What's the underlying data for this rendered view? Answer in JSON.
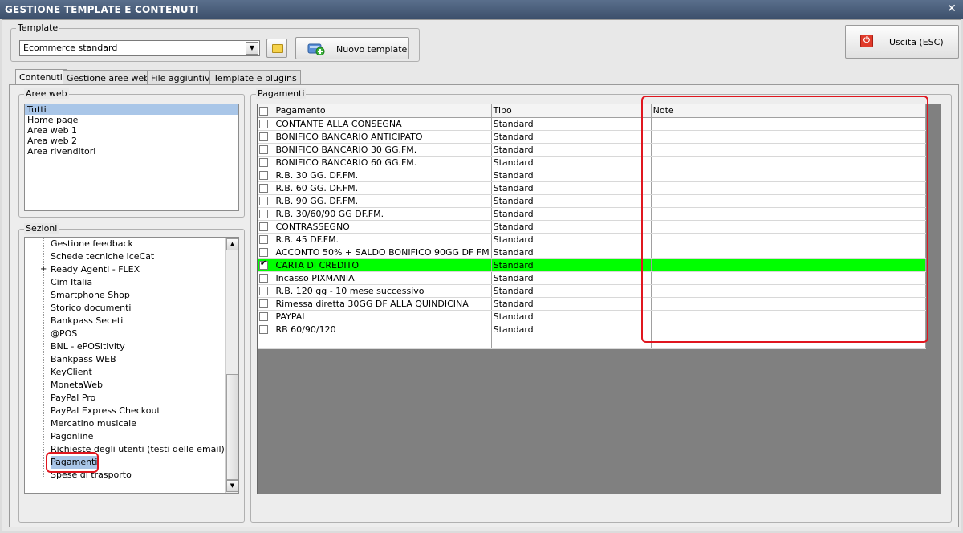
{
  "window": {
    "title": "GESTIONE TEMPLATE E CONTENUTI",
    "close_glyph": "✕"
  },
  "template_group": {
    "legend": "Template",
    "selected": "Ecommerce standard",
    "new_template_label": "Nuovo template",
    "exit_label": "Uscita (ESC)"
  },
  "tabs": [
    "Contenuti",
    "Gestione aree web",
    "File aggiuntivi",
    "Template e plugins"
  ],
  "aree_web": {
    "legend": "Aree web",
    "items": [
      "Tutti",
      "Home page",
      "Area web 1",
      "Area web 2",
      "Area rivenditori"
    ],
    "selected_index": 0
  },
  "sezioni": {
    "legend": "Sezioni",
    "items": [
      "Gestione feedback",
      "Schede tecniche IceCat",
      "Ready Agenti - FLEX",
      "Cim Italia",
      "Smartphone Shop",
      "Storico documenti",
      "Bankpass Seceti",
      "@POS",
      "BNL - ePOSitivity",
      "Bankpass WEB",
      "KeyClient",
      "MonetaWeb",
      "PayPal Pro",
      "PayPal Express Checkout",
      "Mercatino musicale",
      "Pagonline",
      "Richieste degli utenti (testi delle email)",
      "Pagamenti",
      "Spese di trasporto"
    ],
    "selected": "Pagamenti"
  },
  "pagamenti": {
    "legend": "Pagamenti",
    "columns": [
      "Pagamento",
      "Tipo",
      "Note"
    ],
    "rows": [
      {
        "pagamento": "CONTANTE ALLA CONSEGNA",
        "tipo": "Standard",
        "note": "",
        "checked": false
      },
      {
        "pagamento": "BONIFICO BANCARIO ANTICIPATO",
        "tipo": "Standard",
        "note": "",
        "checked": false
      },
      {
        "pagamento": "BONIFICO BANCARIO 30 GG.FM.",
        "tipo": "Standard",
        "note": "",
        "checked": false
      },
      {
        "pagamento": "BONIFICO BANCARIO 60 GG.FM.",
        "tipo": "Standard",
        "note": "",
        "checked": false
      },
      {
        "pagamento": "R.B. 30 GG. DF.FM.",
        "tipo": "Standard",
        "note": "",
        "checked": false
      },
      {
        "pagamento": "R.B. 60 GG. DF.FM.",
        "tipo": "Standard",
        "note": "",
        "checked": false
      },
      {
        "pagamento": "R.B. 90 GG. DF.FM.",
        "tipo": "Standard",
        "note": "",
        "checked": false
      },
      {
        "pagamento": "R.B. 30/60/90 GG DF.FM.",
        "tipo": "Standard",
        "note": "",
        "checked": false
      },
      {
        "pagamento": "CONTRASSEGNO",
        "tipo": "Standard",
        "note": "",
        "checked": false
      },
      {
        "pagamento": "R.B. 45 DF.FM.",
        "tipo": "Standard",
        "note": "",
        "checked": false
      },
      {
        "pagamento": "ACCONTO 50% + SALDO BONIFICO 90GG DF FM",
        "tipo": "Standard",
        "note": "",
        "checked": false
      },
      {
        "pagamento": "CARTA DI CREDITO",
        "tipo": "Standard",
        "note": "",
        "checked": true
      },
      {
        "pagamento": "Incasso PIXMANIA",
        "tipo": "Standard",
        "note": "",
        "checked": false
      },
      {
        "pagamento": "R.B. 120 gg - 10 mese successivo",
        "tipo": "Standard",
        "note": "",
        "checked": false
      },
      {
        "pagamento": "Rimessa diretta 30GG DF ALLA QUINDICINA",
        "tipo": "Standard",
        "note": "",
        "checked": false
      },
      {
        "pagamento": "PAYPAL",
        "tipo": "Standard",
        "note": "",
        "checked": false
      },
      {
        "pagamento": "RB 60/90/120",
        "tipo": "Standard",
        "note": "",
        "checked": false
      }
    ],
    "highlight_color": "#00ff00"
  },
  "colors": {
    "annotation_red": "#e0161f",
    "selection_blue": "#a9c6e8",
    "grid_empty": "#808080"
  }
}
